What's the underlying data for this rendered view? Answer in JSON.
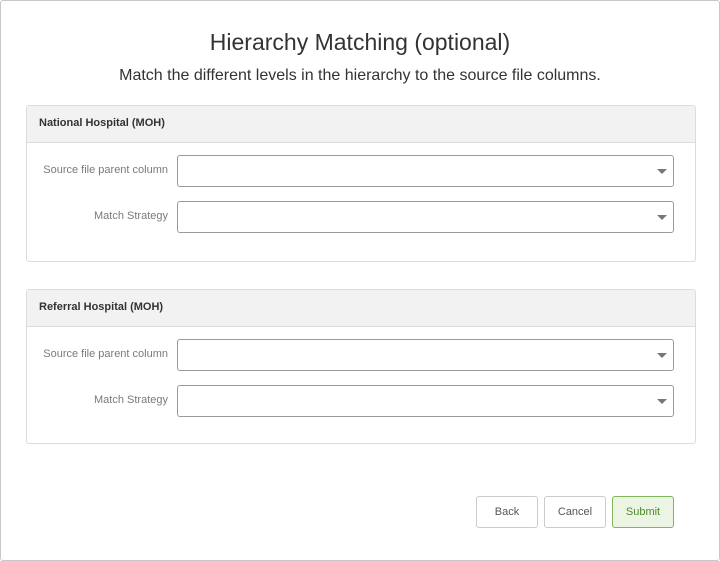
{
  "dialog": {
    "title": "Hierarchy Matching (optional)",
    "subtitle": "Match the different levels in the hierarchy to the source file columns."
  },
  "panels": [
    {
      "heading": "National Hospital (MOH)",
      "fields": [
        {
          "label": "Source file parent column",
          "value": ""
        },
        {
          "label": "Match Strategy",
          "value": ""
        }
      ]
    },
    {
      "heading": "Referral Hospital (MOH)",
      "fields": [
        {
          "label": "Source file parent column",
          "value": ""
        },
        {
          "label": "Match Strategy",
          "value": ""
        }
      ]
    }
  ],
  "buttons": {
    "back": "Back",
    "cancel": "Cancel",
    "submit": "Submit"
  },
  "icons": {
    "dropdown": "chevron-down-icon"
  },
  "colors": {
    "submit_bg": "#ecf5e4",
    "submit_border": "#7fb75a",
    "submit_text": "#4a8a2a"
  }
}
